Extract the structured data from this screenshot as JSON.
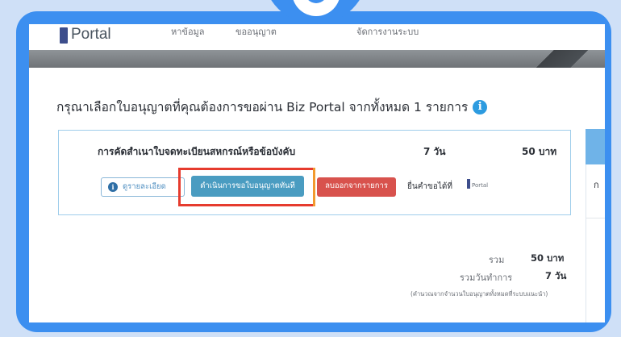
{
  "nav": {
    "logo_text": "Portal",
    "items": [
      "หาข้อมูล",
      "ขออนุญาต",
      "จัดการงานระบบ"
    ]
  },
  "page": {
    "heading": "กรุณาเลือกใบอนุญาตที่คุณต้องการขอผ่าน Biz Portal จากทั้งหมด 1 รายการ",
    "info_icon": "info-icon"
  },
  "license": {
    "title": "การคัดสำเนาใบจดทะเบียนสหกรณ์หรือข้อบังคับ",
    "days": "7 วัน",
    "fee": "50 บาท",
    "detail_button": "ดูรายละเอียด",
    "apply_button": "ดำเนินการขอใบอนุญาตทันที",
    "remove_button": "ลบออกจากรายการ",
    "submit_via": "ยื่นคำขอได้ที่",
    "mini_logo_text": "Portal"
  },
  "summary": {
    "total_label": "รวม",
    "total_value": "50 บาท",
    "days_label": "รวมวันทำการ",
    "days_value": "7 วัน",
    "note": "(คำนวณจากจำนวนใบอนุญาตทั้งหมดที่ระบบแนะนำ)"
  },
  "right_panel": {
    "letter": "ก"
  },
  "colors": {
    "frame": "#3c8ff0",
    "apply_button": "#4a9cc1",
    "remove_button": "#d8524d",
    "highlight_red": "#e63b2e",
    "highlight_orange": "#f29a2e"
  }
}
